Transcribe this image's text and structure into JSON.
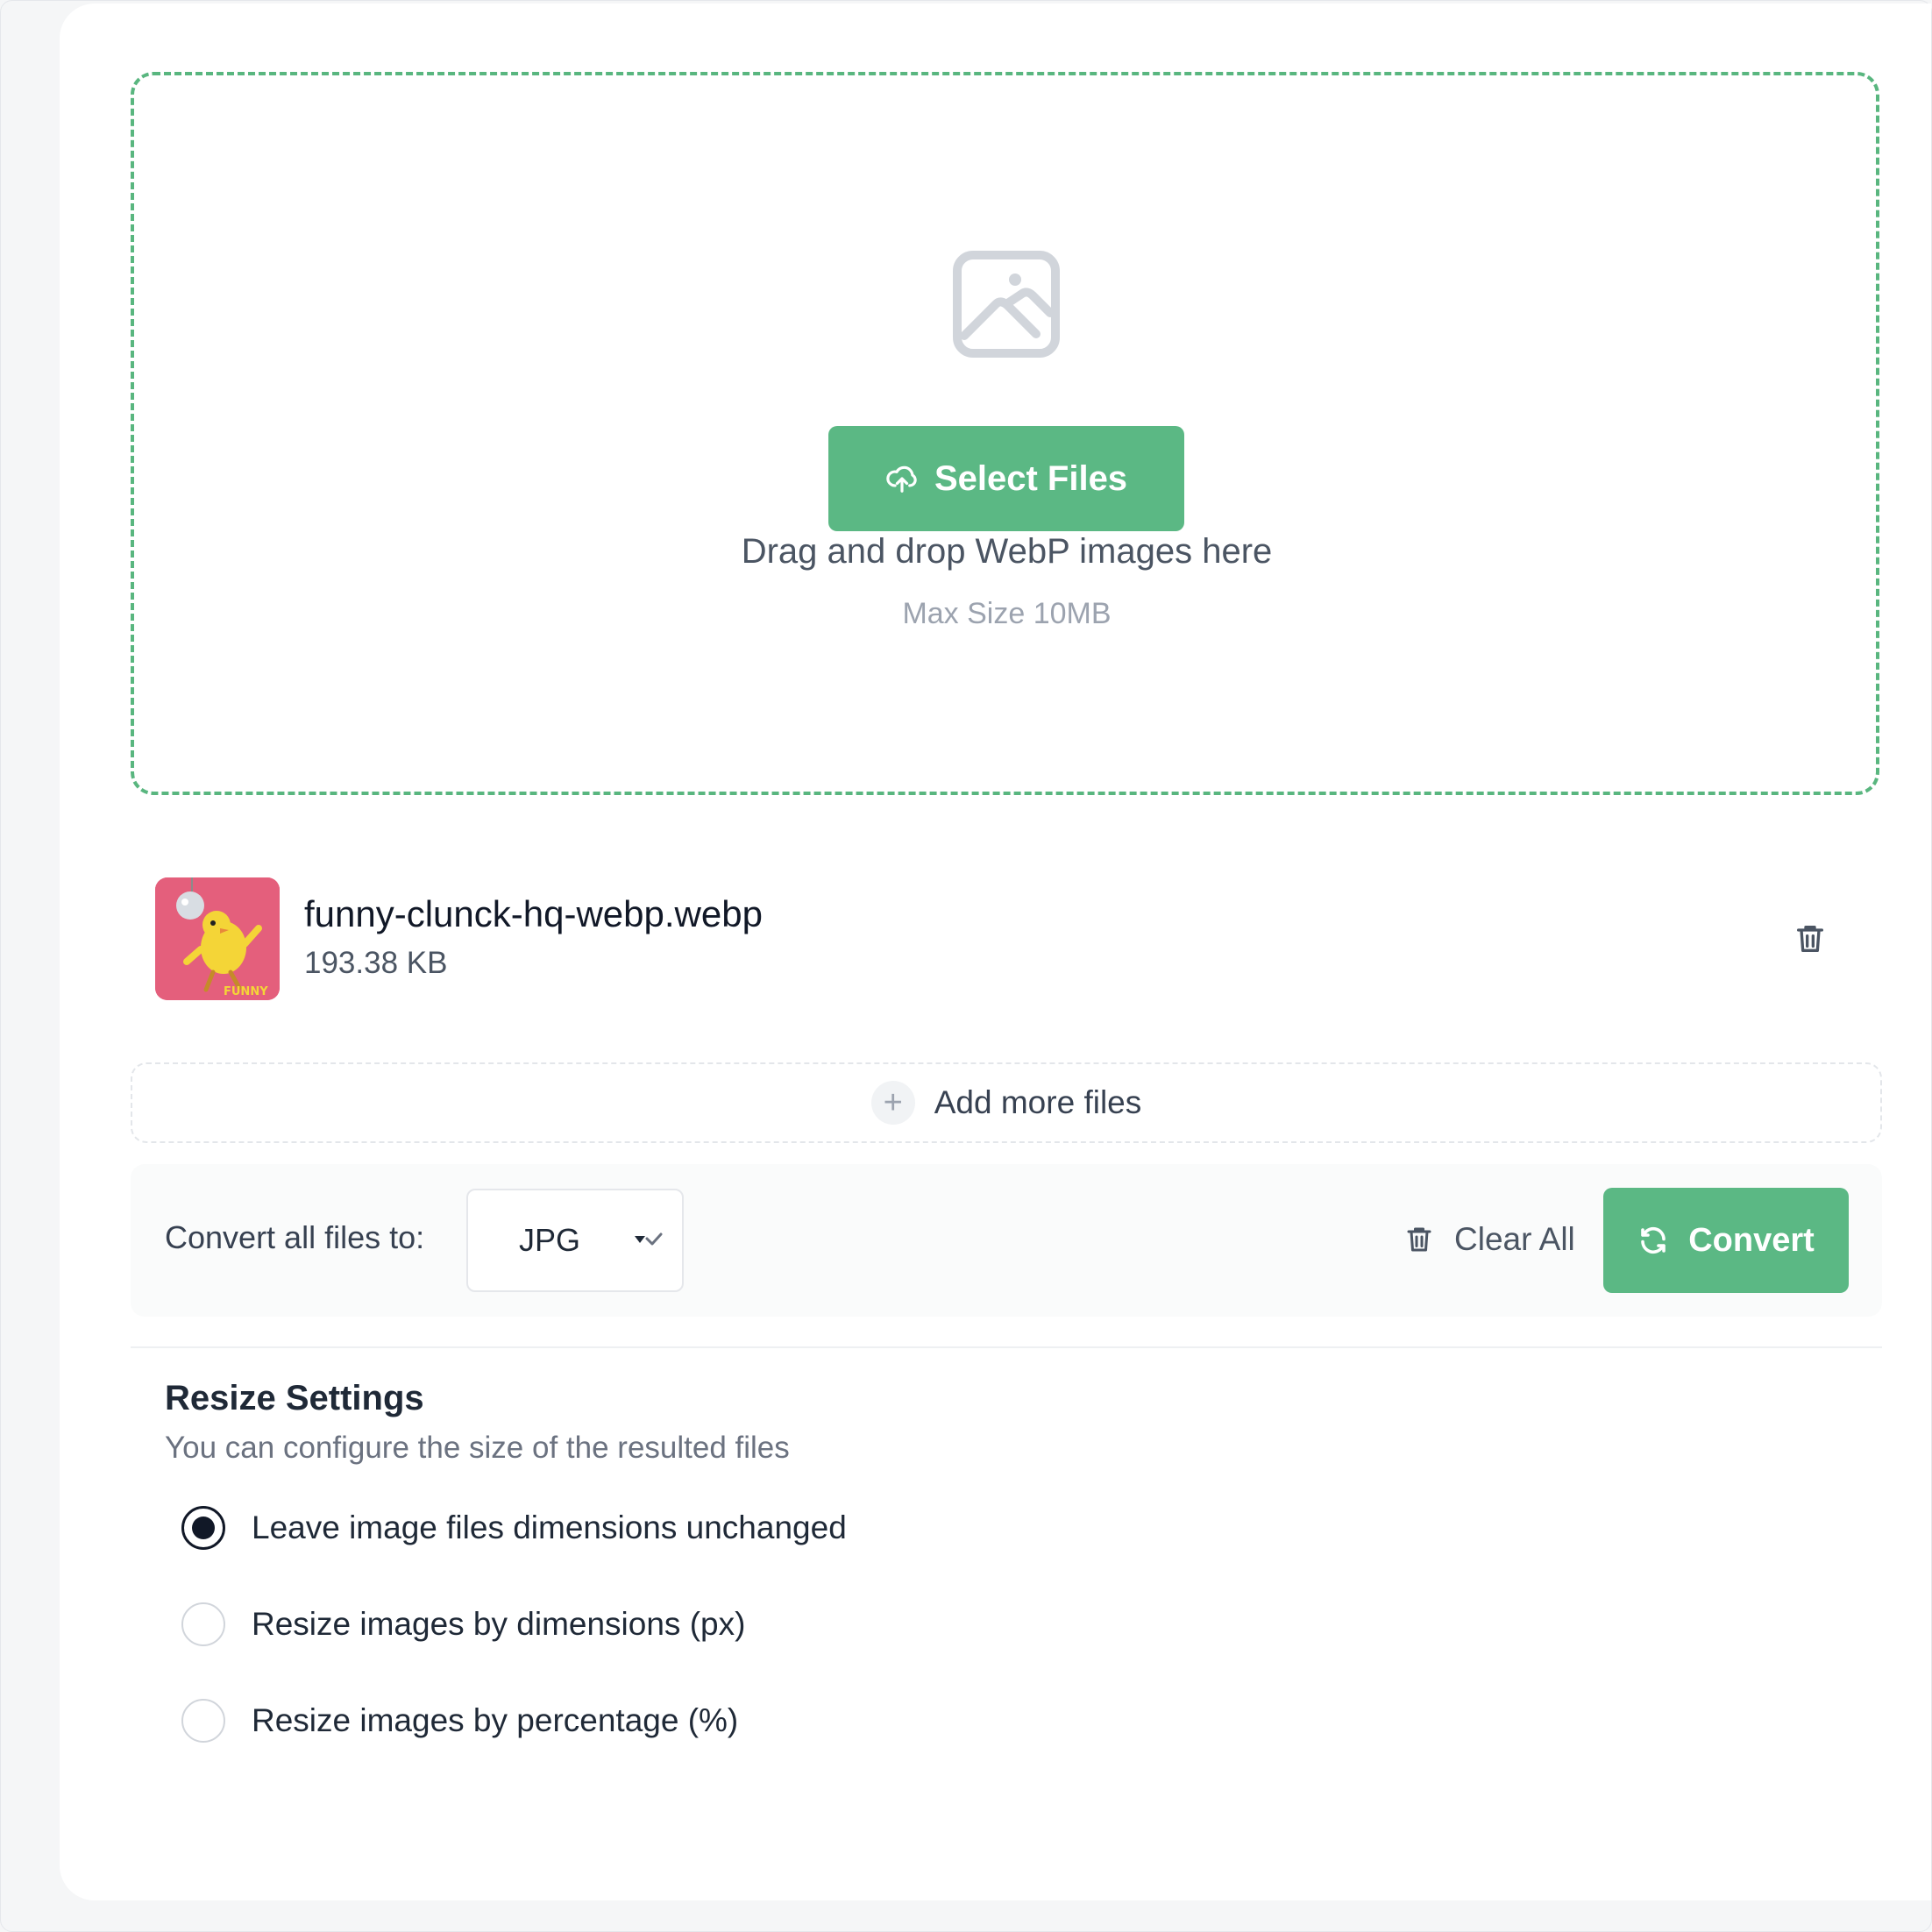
{
  "upload": {
    "select_label": "Select Files",
    "drag_text": "Drag and drop WebP images here",
    "max_size": "Max Size 10MB"
  },
  "file": {
    "name": "funny-clunck-hq-webp.webp",
    "size": "193.38 KB",
    "thumb_caption": "FUNNY"
  },
  "add_more_label": "Add more files",
  "convert": {
    "label": "Convert all files to:",
    "format": "JPG",
    "clear_label": "Clear All",
    "button_label": "Convert"
  },
  "resize": {
    "title": "Resize Settings",
    "subtitle": "You can configure the size of the resulted files",
    "options": [
      {
        "label": "Leave image files dimensions unchanged",
        "checked": true
      },
      {
        "label": "Resize images by dimensions (px)",
        "checked": false
      },
      {
        "label": "Resize images by percentage (%)",
        "checked": false
      }
    ]
  },
  "colors": {
    "accent": "#5bb884",
    "dashed_border": "#59b67f",
    "thumb_bg": "#e45f7c"
  },
  "icons": [
    "image-placeholder-icon",
    "upload-cloud-icon",
    "trash-icon",
    "plus-icon",
    "chevron-down-icon",
    "refresh-icon"
  ]
}
